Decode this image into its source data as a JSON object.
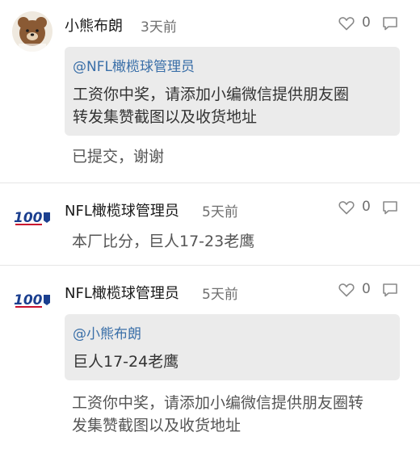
{
  "comments": [
    {
      "username": "小熊布朗",
      "time": "3天前",
      "likes": "0",
      "avatar_icon": "brown-bear-avatar",
      "quote": {
        "mention": "@NFL橄榄球管理员",
        "lines": [
          "工资你中奖，请添加小编微信提供朋友圈",
          "转发集赞截图以及收货地址"
        ]
      },
      "body_lines": [
        "已提交，谢谢"
      ]
    },
    {
      "username": "NFL橄榄球管理员",
      "time": "5天前",
      "likes": "0",
      "avatar_icon": "nfl-100-logo",
      "body_lines": [
        "本厂比分，巨人17-23老鹰"
      ]
    },
    {
      "username": "NFL橄榄球管理员",
      "time": "5天前",
      "likes": "0",
      "avatar_icon": "nfl-100-logo",
      "quote": {
        "mention": "@小熊布朗",
        "lines": [
          "巨人17-24老鹰"
        ]
      },
      "body_lines": [
        "工资你中奖，请添加小编微信提供朋友圈转",
        "发集赞截图以及收货地址"
      ]
    }
  ],
  "icons": {
    "like": "heart-icon",
    "reply": "comment-icon"
  },
  "colors": {
    "mention": "#3a6fa8",
    "quote_bg": "#ebebeb",
    "muted": "#6f6f6f"
  }
}
